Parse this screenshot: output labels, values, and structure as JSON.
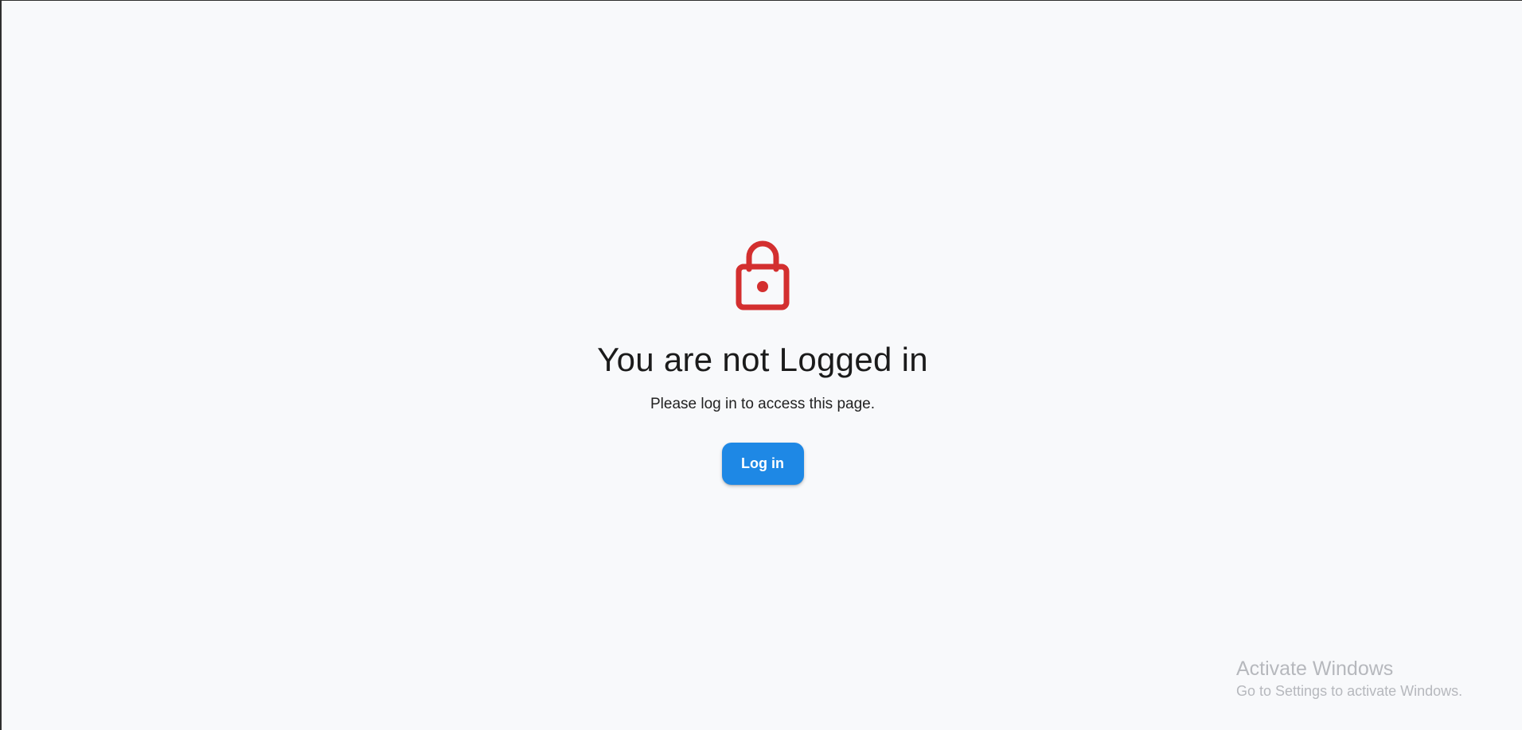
{
  "page": {
    "title": "You are not Logged in",
    "message": "Please log in to access this page.",
    "login_button": "Log in",
    "lock_icon": "lock-icon"
  },
  "watermark": {
    "title": "Activate Windows",
    "subtitle": "Go to Settings to activate Windows."
  },
  "colors": {
    "background": "#f8f9fb",
    "lock": "#d32f2f",
    "button": "#1e88e5",
    "title_text": "#1b1b1b",
    "watermark": "#b6b8bd"
  }
}
